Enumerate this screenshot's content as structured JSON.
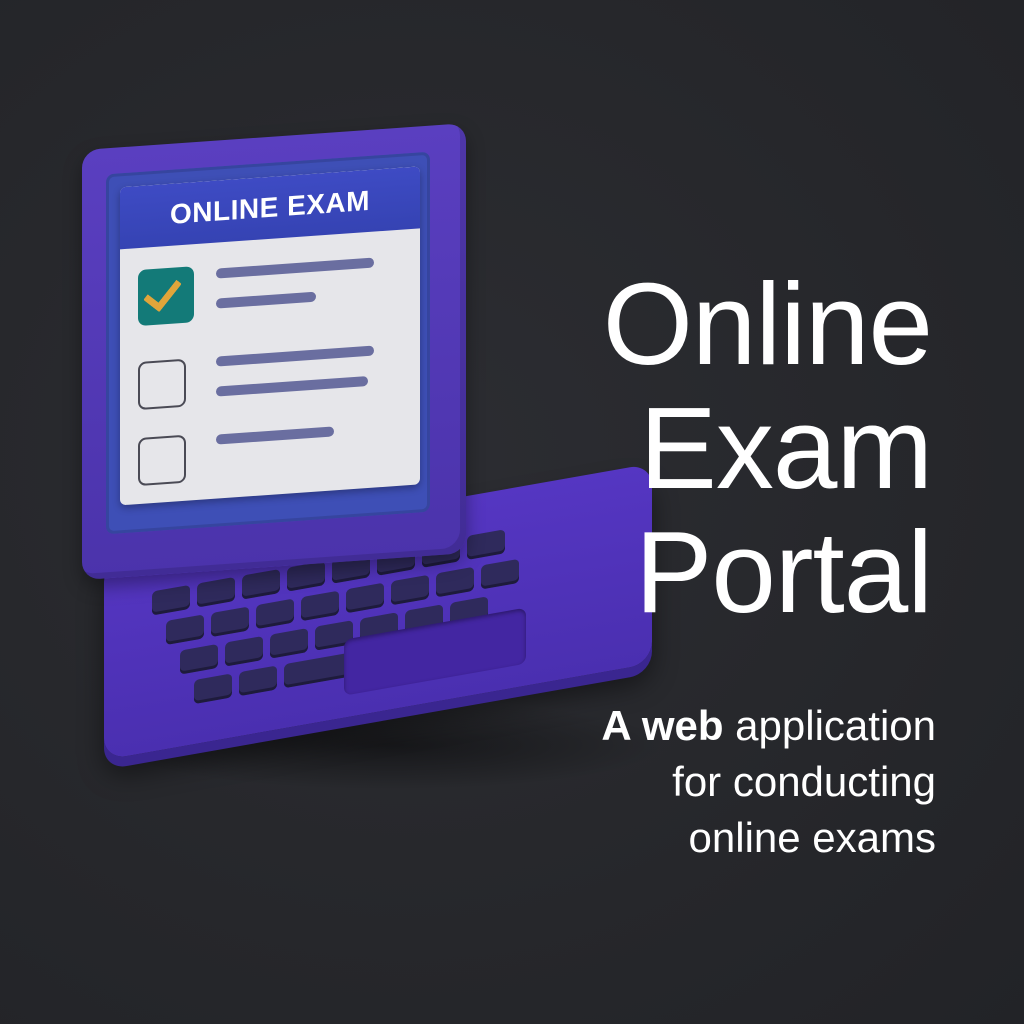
{
  "screen": {
    "header": "ONLINE EXAM",
    "questions": [
      {
        "checked": true,
        "lines": 2
      },
      {
        "checked": false,
        "lines": 2
      },
      {
        "checked": false,
        "lines": 1
      }
    ]
  },
  "title": {
    "line1": "Online",
    "line2": "Exam",
    "line3": "Portal"
  },
  "subtitle": {
    "strong": "A web",
    "rest_line1": " application",
    "line2": "for conducting",
    "line3": "online exams"
  },
  "colors": {
    "background": "#26272b",
    "laptop": "#4b33ab",
    "screen_header": "#3543b3",
    "check": "#137a78",
    "tick": "#e0a53a"
  },
  "icons": [
    "laptop-icon",
    "checkmark-icon"
  ]
}
